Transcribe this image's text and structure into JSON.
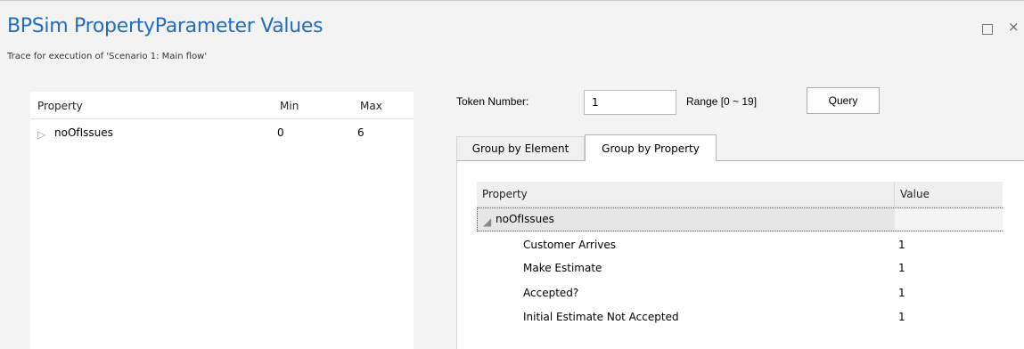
{
  "window": {
    "title": "BPSim PropertyParameter Values",
    "subtitle": "Trace for execution of 'Scenario 1: Main flow'",
    "restore_icon": "restore-icon",
    "close_glyph": "×"
  },
  "left_table": {
    "columns": [
      "Property",
      "Min",
      "Max"
    ],
    "rows": [
      {
        "expander": "▷",
        "property": "noOfIssues",
        "min": "0",
        "max": "6"
      }
    ]
  },
  "query": {
    "token_label": "Token Number:",
    "token_value": "1",
    "range_label": "Range [0 ~ 19]",
    "button_label": "Query"
  },
  "tabs": [
    {
      "label": "Group by Element",
      "active": false
    },
    {
      "label": "Group by Property",
      "active": true
    }
  ],
  "grid": {
    "columns": [
      "Property",
      "Value"
    ],
    "group": {
      "expander": "◢",
      "label": "noOfIssues"
    },
    "rows": [
      {
        "property": "Customer Arrives",
        "value": "1"
      },
      {
        "property": "Make Estimate",
        "value": "1"
      },
      {
        "property": "Accepted?",
        "value": "1"
      },
      {
        "property": "Initial Estimate Not Accepted",
        "value": "1"
      }
    ]
  }
}
